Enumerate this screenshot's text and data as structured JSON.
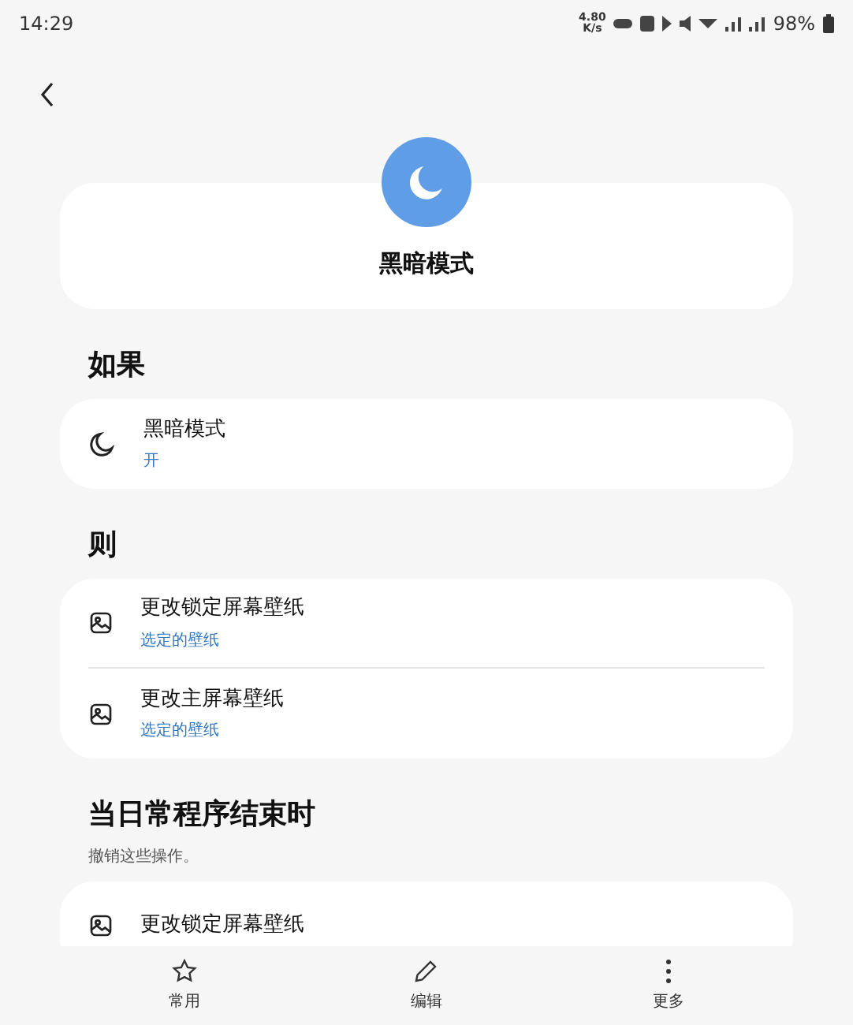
{
  "status_bar": {
    "time": "14:29",
    "speed_value": "4.80",
    "speed_unit": "K/s",
    "battery": "98%"
  },
  "header": {
    "title": "黑暗模式"
  },
  "sections": [
    {
      "heading": "如果",
      "rows": [
        {
          "kind": "moon",
          "title": "黑暗模式",
          "subtitle": "开"
        }
      ]
    },
    {
      "heading": "则",
      "rows": [
        {
          "kind": "image",
          "title": "更改锁定屏幕壁纸",
          "subtitle": "选定的壁纸"
        },
        {
          "kind": "image",
          "title": "更改主屏幕壁纸",
          "subtitle": "选定的壁纸"
        }
      ]
    },
    {
      "heading": "当日常程序结束时",
      "description": "撤销这些操作。",
      "rows": [
        {
          "kind": "image",
          "title": "更改锁定屏幕壁纸"
        }
      ]
    }
  ],
  "bottom_nav": [
    {
      "kind": "star",
      "label": "常用"
    },
    {
      "kind": "pencil",
      "label": "编辑"
    },
    {
      "kind": "more",
      "label": "更多"
    }
  ]
}
